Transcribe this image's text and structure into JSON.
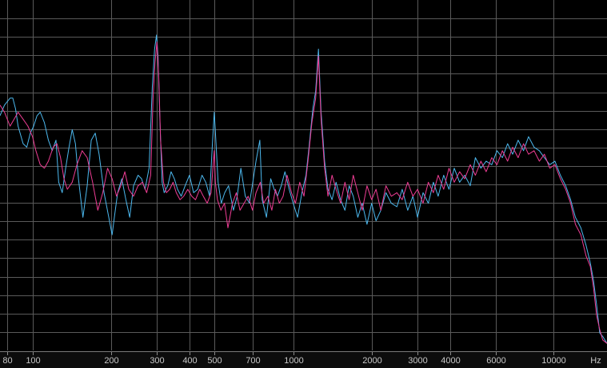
{
  "chart_data": {
    "type": "line",
    "x_scale": "log",
    "xlim": [
      75,
      16000
    ],
    "ylim": [
      0,
      100
    ],
    "grid": true,
    "tick_labels": [
      "80",
      "100",
      "200",
      "300",
      "400",
      "500",
      "700",
      "1000",
      "2000",
      "3000",
      "4000",
      "6000",
      "10000"
    ],
    "ticks": [
      80,
      100,
      200,
      300,
      400,
      500,
      700,
      1000,
      2000,
      3000,
      4000,
      6000,
      10000
    ],
    "xlabel": "Hz",
    "series": [
      {
        "color": "#4cb8ee",
        "points": [
          [
            75,
            67
          ],
          [
            78,
            70
          ],
          [
            80,
            71
          ],
          [
            82,
            72
          ],
          [
            84,
            72
          ],
          [
            86,
            69
          ],
          [
            88,
            64
          ],
          [
            92,
            59
          ],
          [
            95,
            58
          ],
          [
            98,
            62
          ],
          [
            101,
            64
          ],
          [
            104,
            67
          ],
          [
            107,
            68
          ],
          [
            111,
            65
          ],
          [
            115,
            60
          ],
          [
            119,
            57
          ],
          [
            123,
            60
          ],
          [
            126,
            48
          ],
          [
            130,
            45
          ],
          [
            134,
            52
          ],
          [
            138,
            58
          ],
          [
            142,
            63
          ],
          [
            146,
            59
          ],
          [
            150,
            49
          ],
          [
            156,
            38
          ],
          [
            162,
            47
          ],
          [
            168,
            60
          ],
          [
            174,
            62
          ],
          [
            180,
            56
          ],
          [
            188,
            45
          ],
          [
            196,
            38
          ],
          [
            202,
            33
          ],
          [
            206,
            38
          ],
          [
            212,
            45
          ],
          [
            220,
            49
          ],
          [
            228,
            43
          ],
          [
            236,
            38
          ],
          [
            244,
            47
          ],
          [
            254,
            50
          ],
          [
            262,
            49
          ],
          [
            270,
            46
          ],
          [
            280,
            52
          ],
          [
            288,
            75
          ],
          [
            294,
            86
          ],
          [
            299,
            90
          ],
          [
            303,
            84
          ],
          [
            308,
            66
          ],
          [
            314,
            48
          ],
          [
            320,
            45
          ],
          [
            330,
            47
          ],
          [
            340,
            51
          ],
          [
            350,
            49
          ],
          [
            360,
            46
          ],
          [
            372,
            44
          ],
          [
            385,
            47
          ],
          [
            400,
            50
          ],
          [
            415,
            45
          ],
          [
            430,
            46
          ],
          [
            447,
            50
          ],
          [
            462,
            48
          ],
          [
            478,
            44
          ],
          [
            490,
            59
          ],
          [
            498,
            68
          ],
          [
            505,
            60
          ],
          [
            515,
            48
          ],
          [
            530,
            42
          ],
          [
            546,
            45
          ],
          [
            565,
            47
          ],
          [
            590,
            40
          ],
          [
            610,
            44
          ],
          [
            630,
            52
          ],
          [
            655,
            44
          ],
          [
            680,
            42
          ],
          [
            700,
            48
          ],
          [
            720,
            54
          ],
          [
            745,
            60
          ],
          [
            760,
            43
          ],
          [
            790,
            38
          ],
          [
            820,
            49
          ],
          [
            845,
            46
          ],
          [
            870,
            44
          ],
          [
            900,
            47
          ],
          [
            930,
            51
          ],
          [
            965,
            46
          ],
          [
            1000,
            42
          ],
          [
            1040,
            38
          ],
          [
            1080,
            45
          ],
          [
            1120,
            50
          ],
          [
            1150,
            58
          ],
          [
            1190,
            69
          ],
          [
            1220,
            74
          ],
          [
            1250,
            86
          ],
          [
            1280,
            68
          ],
          [
            1320,
            54
          ],
          [
            1360,
            46
          ],
          [
            1410,
            43
          ],
          [
            1460,
            48
          ],
          [
            1520,
            43
          ],
          [
            1580,
            40
          ],
          [
            1640,
            47
          ],
          [
            1700,
            44
          ],
          [
            1770,
            38
          ],
          [
            1840,
            42
          ],
          [
            1920,
            36
          ],
          [
            2000,
            42
          ],
          [
            2080,
            37
          ],
          [
            2170,
            40
          ],
          [
            2270,
            45
          ],
          [
            2380,
            42
          ],
          [
            2500,
            41
          ],
          [
            2620,
            46
          ],
          [
            2750,
            40
          ],
          [
            2880,
            44
          ],
          [
            3000,
            38
          ],
          [
            3150,
            45
          ],
          [
            3300,
            42
          ],
          [
            3450,
            48
          ],
          [
            3600,
            44
          ],
          [
            3780,
            50
          ],
          [
            3960,
            46
          ],
          [
            4150,
            52
          ],
          [
            4350,
            48
          ],
          [
            4550,
            50
          ],
          [
            4780,
            47
          ],
          [
            5000,
            55
          ],
          [
            5250,
            52
          ],
          [
            5500,
            54
          ],
          [
            5780,
            53
          ],
          [
            6050,
            57
          ],
          [
            6350,
            55
          ],
          [
            6650,
            59
          ],
          [
            6950,
            56
          ],
          [
            7300,
            60
          ],
          [
            7650,
            57
          ],
          [
            8000,
            61
          ],
          [
            8400,
            58
          ],
          [
            8800,
            57
          ],
          [
            9200,
            55
          ],
          [
            9650,
            53
          ],
          [
            10100,
            54
          ],
          [
            10600,
            50
          ],
          [
            11100,
            47
          ],
          [
            11600,
            43
          ],
          [
            12100,
            38
          ],
          [
            12700,
            35
          ],
          [
            13300,
            30
          ],
          [
            13800,
            25
          ],
          [
            14200,
            20
          ],
          [
            14600,
            13
          ],
          [
            15000,
            5
          ],
          [
            15400,
            4
          ],
          [
            16000,
            2
          ]
        ]
      },
      {
        "color": "#ee3d94",
        "points": [
          [
            75,
            70
          ],
          [
            78,
            68
          ],
          [
            80,
            66
          ],
          [
            82,
            64
          ],
          [
            85,
            66
          ],
          [
            88,
            68
          ],
          [
            92,
            66
          ],
          [
            96,
            64
          ],
          [
            100,
            61
          ],
          [
            103,
            57
          ],
          [
            107,
            53
          ],
          [
            111,
            52
          ],
          [
            115,
            54
          ],
          [
            120,
            58
          ],
          [
            124,
            59
          ],
          [
            128,
            55
          ],
          [
            132,
            49
          ],
          [
            136,
            46
          ],
          [
            142,
            48
          ],
          [
            148,
            53
          ],
          [
            155,
            57
          ],
          [
            162,
            55
          ],
          [
            170,
            48
          ],
          [
            178,
            40
          ],
          [
            186,
            45
          ],
          [
            194,
            52
          ],
          [
            202,
            49
          ],
          [
            210,
            44
          ],
          [
            218,
            47
          ],
          [
            226,
            51
          ],
          [
            234,
            46
          ],
          [
            244,
            44
          ],
          [
            254,
            47
          ],
          [
            264,
            48
          ],
          [
            274,
            45
          ],
          [
            284,
            50
          ],
          [
            290,
            72
          ],
          [
            295,
            82
          ],
          [
            300,
            88
          ],
          [
            305,
            78
          ],
          [
            310,
            60
          ],
          [
            318,
            48
          ],
          [
            326,
            45
          ],
          [
            336,
            46
          ],
          [
            346,
            48
          ],
          [
            356,
            45
          ],
          [
            368,
            43
          ],
          [
            380,
            44
          ],
          [
            394,
            46
          ],
          [
            408,
            44
          ],
          [
            422,
            43
          ],
          [
            438,
            46
          ],
          [
            452,
            44
          ],
          [
            468,
            42
          ],
          [
            484,
            45
          ],
          [
            498,
            57
          ],
          [
            503,
            48
          ],
          [
            512,
            43
          ],
          [
            528,
            40
          ],
          [
            545,
            42
          ],
          [
            562,
            35
          ],
          [
            585,
            42
          ],
          [
            605,
            45
          ],
          [
            625,
            40
          ],
          [
            648,
            42
          ],
          [
            672,
            44
          ],
          [
            698,
            40
          ],
          [
            720,
            45
          ],
          [
            748,
            48
          ],
          [
            770,
            42
          ],
          [
            800,
            44
          ],
          [
            828,
            40
          ],
          [
            855,
            46
          ],
          [
            885,
            42
          ],
          [
            915,
            44
          ],
          [
            948,
            50
          ],
          [
            985,
            45
          ],
          [
            1020,
            42
          ],
          [
            1060,
            48
          ],
          [
            1100,
            44
          ],
          [
            1140,
            54
          ],
          [
            1180,
            65
          ],
          [
            1220,
            72
          ],
          [
            1250,
            84
          ],
          [
            1280,
            66
          ],
          [
            1320,
            52
          ],
          [
            1360,
            44
          ],
          [
            1410,
            50
          ],
          [
            1460,
            46
          ],
          [
            1520,
            42
          ],
          [
            1580,
            48
          ],
          [
            1640,
            43
          ],
          [
            1700,
            50
          ],
          [
            1770,
            45
          ],
          [
            1840,
            40
          ],
          [
            1920,
            47
          ],
          [
            2000,
            43
          ],
          [
            2080,
            46
          ],
          [
            2170,
            40
          ],
          [
            2270,
            47
          ],
          [
            2380,
            44
          ],
          [
            2500,
            45
          ],
          [
            2620,
            43
          ],
          [
            2750,
            48
          ],
          [
            2880,
            44
          ],
          [
            3000,
            46
          ],
          [
            3150,
            42
          ],
          [
            3300,
            48
          ],
          [
            3450,
            45
          ],
          [
            3600,
            50
          ],
          [
            3780,
            46
          ],
          [
            3960,
            52
          ],
          [
            4150,
            48
          ],
          [
            4350,
            51
          ],
          [
            4550,
            49
          ],
          [
            4780,
            53
          ],
          [
            5000,
            50
          ],
          [
            5250,
            54
          ],
          [
            5500,
            51
          ],
          [
            5780,
            55
          ],
          [
            6050,
            53
          ],
          [
            6350,
            57
          ],
          [
            6650,
            54
          ],
          [
            6950,
            58
          ],
          [
            7300,
            55
          ],
          [
            7650,
            59
          ],
          [
            8000,
            56
          ],
          [
            8400,
            57
          ],
          [
            8800,
            54
          ],
          [
            9200,
            56
          ],
          [
            9650,
            52
          ],
          [
            10100,
            53
          ],
          [
            10600,
            49
          ],
          [
            11100,
            46
          ],
          [
            11600,
            42
          ],
          [
            12100,
            36
          ],
          [
            12700,
            33
          ],
          [
            13300,
            27
          ],
          [
            13800,
            24
          ],
          [
            14200,
            18
          ],
          [
            14600,
            10
          ],
          [
            15000,
            6
          ],
          [
            15400,
            3
          ],
          [
            16000,
            2
          ]
        ]
      }
    ]
  }
}
